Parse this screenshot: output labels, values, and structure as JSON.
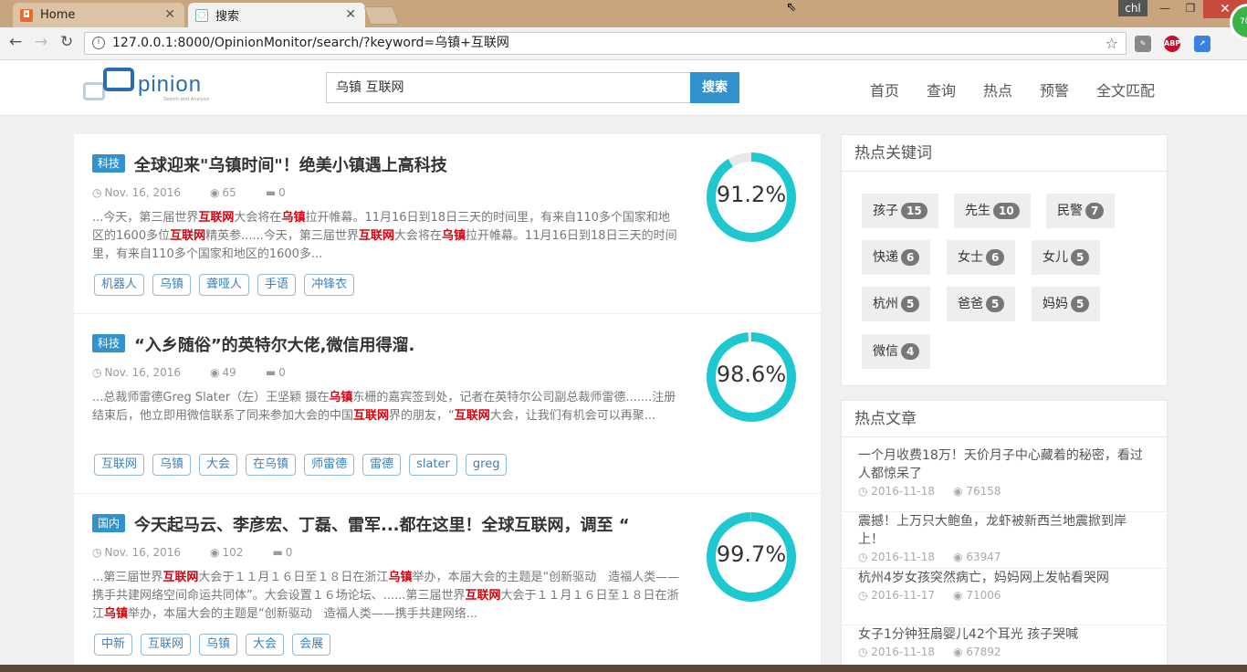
{
  "browser": {
    "tabs": [
      {
        "label": "Home",
        "active": false
      },
      {
        "label": "搜索",
        "active": true
      }
    ],
    "url": "127.0.0.1:8000/OpinionMonitor/search/?keyword=乌镇+互联网",
    "user": "chl",
    "badge": "70"
  },
  "header": {
    "logo_text": "pinion",
    "logo_sub": "Search and Analysis",
    "search_value": "乌镇 互联网",
    "search_button": "搜索",
    "nav": [
      "首页",
      "查询",
      "热点",
      "预警",
      "全文匹配"
    ]
  },
  "articles": [
    {
      "category": "科技",
      "title": "全球迎来\"乌镇时间\"！绝美小镇遇上高科技",
      "date": "Nov. 16, 2016",
      "views": "65",
      "comments": "0",
      "snippet": [
        {
          "t": "...今天，第三届世界"
        },
        {
          "t": "互联网",
          "hl": true
        },
        {
          "t": "大会将在"
        },
        {
          "t": "乌镇",
          "hl": true
        },
        {
          "t": "拉开帷幕。11月16日到18日三天的时间里，有来自110多个国家和地区的1600多位"
        },
        {
          "t": "互联网",
          "hl": true
        },
        {
          "t": "精英参......今天，第三届世界"
        },
        {
          "t": "互联网",
          "hl": true
        },
        {
          "t": "大会将在"
        },
        {
          "t": "乌镇",
          "hl": true
        },
        {
          "t": "拉开帷幕。11月16日到18日三天的时间里，有来自110多个国家和地区的1600多..."
        }
      ],
      "tags": [
        "机器人",
        "乌镇",
        "聋哑人",
        "手语",
        "冲锋衣"
      ],
      "score": "91.2%",
      "score_value": 91.2
    },
    {
      "category": "科技",
      "title": "“入乡随俗”的英特尔大佬,微信用得溜.",
      "date": "Nov. 16, 2016",
      "views": "49",
      "comments": "0",
      "snippet": [
        {
          "t": "...总裁师雷德Greg Slater（左）王坚颖 摄在"
        },
        {
          "t": "乌镇",
          "hl": true
        },
        {
          "t": "东栅的嘉宾签到处，记者在英特尔公司副总裁师雷德.......注册结束后，他立即用微信联系了同来参加大会的中国"
        },
        {
          "t": "互联网",
          "hl": true
        },
        {
          "t": "界的朋友，“"
        },
        {
          "t": "互联网",
          "hl": true
        },
        {
          "t": "大会，让我们有机会可以再聚..."
        }
      ],
      "tags": [
        "互联网",
        "乌镇",
        "大会",
        "在乌镇",
        "师雷德",
        "雷德",
        "slater",
        "greg"
      ],
      "score": "98.6%",
      "score_value": 98.6
    },
    {
      "category": "国内",
      "title": "今天起马云、李彦宏、丁磊、雷军...都在这里！全球互联网，调至 “",
      "date": "Nov. 16, 2016",
      "views": "102",
      "comments": "0",
      "snippet": [
        {
          "t": "...第三届世界"
        },
        {
          "t": "互联网",
          "hl": true
        },
        {
          "t": "大会于１１月１６日至１８日在浙江"
        },
        {
          "t": "乌镇",
          "hl": true
        },
        {
          "t": "举办，本届大会的主题是“创新驱动　造福人类——携手共建网络空间命运共同体”。大会设置１６场论坛、......第三届世界"
        },
        {
          "t": "互联网",
          "hl": true
        },
        {
          "t": "大会于１１月１６日至１８日在浙江"
        },
        {
          "t": "乌镇",
          "hl": true
        },
        {
          "t": "举办，本届大会的主题是“创新驱动　造福人类——携手共建网络..."
        }
      ],
      "tags": [
        "中新",
        "互联网",
        "乌镇",
        "大会",
        "会展"
      ],
      "score": "99.7%",
      "score_value": 99.7
    }
  ],
  "sidebar": {
    "keywords_title": "热点关键词",
    "keywords": [
      {
        "word": "孩子",
        "count": "15"
      },
      {
        "word": "先生",
        "count": "10"
      },
      {
        "word": "民警",
        "count": "7"
      },
      {
        "word": "快递",
        "count": "6"
      },
      {
        "word": "女士",
        "count": "6"
      },
      {
        "word": "女儿",
        "count": "5"
      },
      {
        "word": "杭州",
        "count": "5"
      },
      {
        "word": "爸爸",
        "count": "5"
      },
      {
        "word": "妈妈",
        "count": "5"
      },
      {
        "word": "微信",
        "count": "4"
      }
    ],
    "hot_title": "热点文章",
    "hot_articles": [
      {
        "title": "一个月收费18万！天价月子中心藏着的秘密，看过人都惊呆了",
        "date": "2016-11-18",
        "views": "76158"
      },
      {
        "title": "震撼！上万只大鲍鱼，龙虾被新西兰地震掀到岸上！",
        "date": "2016-11-18",
        "views": "63947"
      },
      {
        "title": "杭州4岁女孩突然病亡，妈妈网上发帖看哭网",
        "date": "2016-11-17",
        "views": "71006"
      },
      {
        "title": "女子1分钟狂扇婴儿42个耳光 孩子哭喊",
        "date": "2016-11-18",
        "views": "67892"
      }
    ]
  },
  "colors": {
    "accent": "#3292ce",
    "ring": "#1ec8d0",
    "highlight": "#d8000c"
  }
}
